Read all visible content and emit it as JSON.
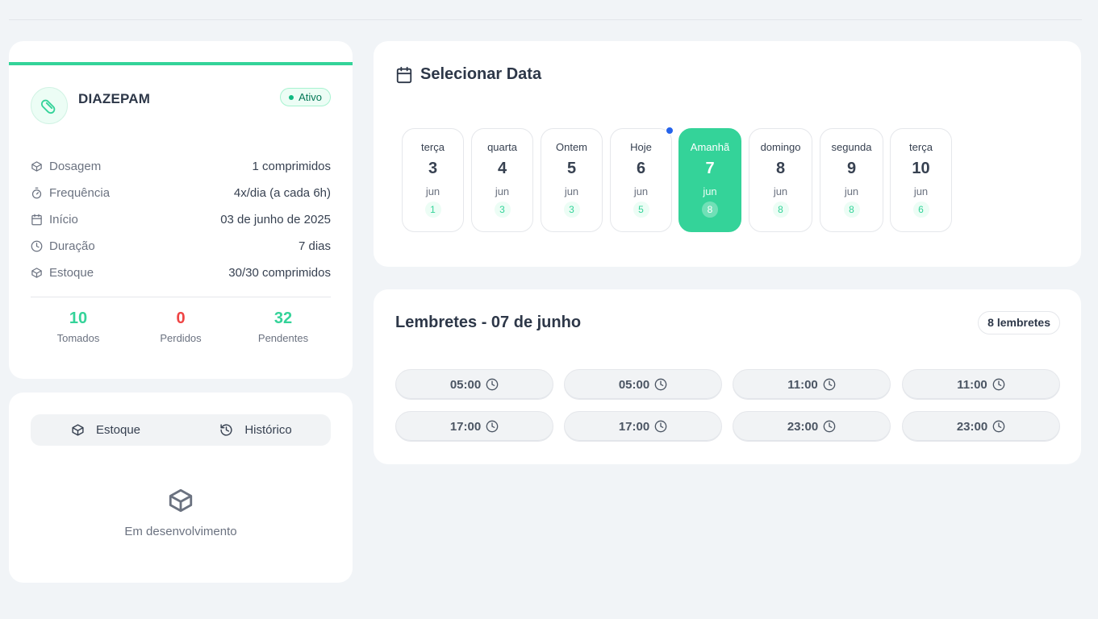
{
  "medication": {
    "name": "DIAZEPAM",
    "status": "Ativo",
    "details": [
      {
        "label": "Dosagem",
        "value": "1 comprimidos",
        "icon": "box-icon"
      },
      {
        "label": "Frequência",
        "value": "4x/dia (a cada 6h)",
        "icon": "timer-icon"
      },
      {
        "label": "Início",
        "value": "03 de junho de 2025",
        "icon": "calendar-icon"
      },
      {
        "label": "Duração",
        "value": "7 dias",
        "icon": "clock-icon"
      },
      {
        "label": "Estoque",
        "value": "30/30 comprimidos",
        "icon": "box-icon"
      }
    ],
    "stats": [
      {
        "value": "10",
        "label": "Tomados",
        "color": "#34d399"
      },
      {
        "value": "0",
        "label": "Perdidos",
        "color": "#ef4444"
      },
      {
        "value": "32",
        "label": "Pendentes",
        "color": "#34d399"
      }
    ]
  },
  "stock_panel": {
    "tabs": [
      {
        "label": "Estoque",
        "icon": "box-icon"
      },
      {
        "label": "Histórico",
        "icon": "history-icon"
      }
    ],
    "placeholder": "Em desenvolvimento"
  },
  "date_picker": {
    "title": "Selecionar Data",
    "days": [
      {
        "name": "terça",
        "num": "3",
        "month": "jun",
        "count": "1"
      },
      {
        "name": "quarta",
        "num": "4",
        "month": "jun",
        "count": "3"
      },
      {
        "name": "Ontem",
        "num": "5",
        "month": "jun",
        "count": "3"
      },
      {
        "name": "Hoje",
        "num": "6",
        "month": "jun",
        "count": "5"
      },
      {
        "name": "Amanhã",
        "num": "7",
        "month": "jun",
        "count": "8"
      },
      {
        "name": "domingo",
        "num": "8",
        "month": "jun",
        "count": "8"
      },
      {
        "name": "segunda",
        "num": "9",
        "month": "jun",
        "count": "8"
      },
      {
        "name": "terça",
        "num": "10",
        "month": "jun",
        "count": "6"
      }
    ]
  },
  "reminders": {
    "title": "Lembretes - 07 de junho",
    "count_label": "8 lembretes",
    "times": [
      "05:00",
      "05:00",
      "11:00",
      "11:00",
      "17:00",
      "17:00",
      "23:00",
      "23:00"
    ]
  },
  "colors": {
    "accent": "#34d399",
    "danger": "#ef4444",
    "today_dot": "#2563eb"
  }
}
